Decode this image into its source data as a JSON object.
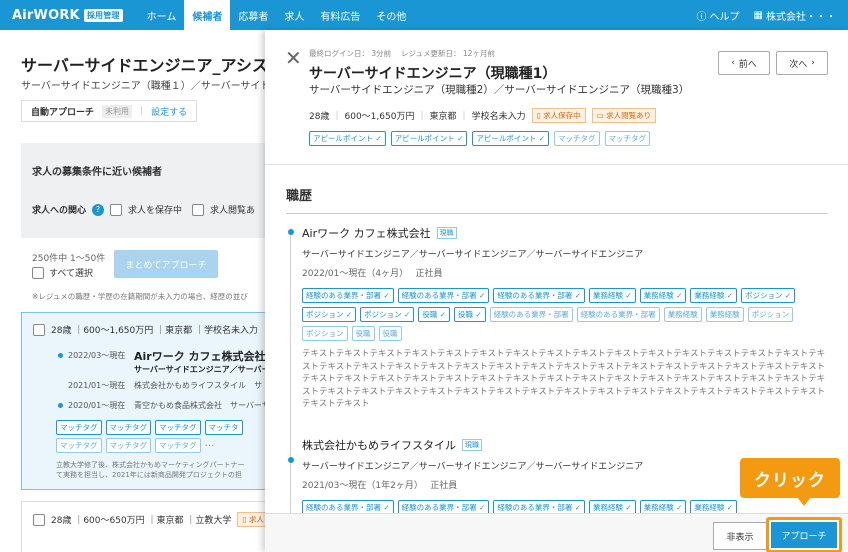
{
  "topbar": {
    "logo": "AirWORK",
    "logo_badge": "採用管理",
    "nav": [
      "ホーム",
      "候補者",
      "応募者",
      "求人",
      "有料広告",
      "その他"
    ],
    "help": "ヘルプ",
    "company": "株式会社・・・"
  },
  "left": {
    "title": "サーバーサイドエンジニア_アシス",
    "subtitle": "サーバーサイドエンジニア（職種１）／サーバーサイドエン",
    "auto_label": "自動アプローチ",
    "auto_status": "未利用",
    "auto_link": "設定する",
    "filter_title": "求人の募集条件に近い候補者",
    "interest_label": "求人への関心",
    "opt_saved": "求人を保存中",
    "opt_viewed": "求人閲覧あ",
    "count": "250件中 1〜50件",
    "select_all": "すべて選択",
    "bulk_button": "まとめてアプローチ",
    "note": "※レジュメの職歴・学歴の在籍期間が未入力の場合、経歴の並び"
  },
  "card1": {
    "summary": "28歳 ｜600〜1,650万円 ｜東京都 ｜学校名未入力",
    "period1": "2022/03〜現在",
    "company1": "Airワーク カフェ株式会社",
    "role1": "サーバーサイドエンジニア／サーバー",
    "period2": "2021/01〜現在",
    "company2": "株式会社かもめライフスタイル　サ",
    "period3": "2020/01〜現在",
    "company3": "青空かもめ食品株式会社　サーバーサ",
    "tags_row1": [
      "マッチタグ",
      "マッチタグ",
      "マッチタグ",
      "マッチタ"
    ],
    "tags_row2": [
      "マッチタグ",
      "マッチタグ",
      "マッチタグ"
    ],
    "ellipsis": "…",
    "desc1": "立教大学修了後、株式会社かもめマーケティングパートナー",
    "desc2": "て実務を担当し、2021年には新商品開発プロジェクトの担"
  },
  "card2": {
    "summary": "28歳 ｜600〜650万円 ｜東京都 ｜立教大学",
    "badge": "求人"
  },
  "panel": {
    "login_meta": "最終ログイン日： 3分前　 レジュメ更新日： 12ヶ月前",
    "name": "サーバーサイドエンジニア（現職種1）",
    "sub": "サーバーサイドエンジニア（現職種2）／サーバーサイドエンジニア（現職種3）",
    "age": "28歳",
    "salary": "600〜1,650万円",
    "location": "東京都",
    "school": "学校名未入力",
    "saved_badge": "求人保存中",
    "viewed_badge": "求人閲覧あり",
    "appeal_tags": [
      "アピールポイント",
      "アピールポイント",
      "アピールポイント"
    ],
    "match_tags": [
      "マッチタグ",
      "マッチタグ"
    ],
    "prev": "前へ",
    "next": "次へ",
    "section_title": "職歴",
    "job1": {
      "company": "Airワーク カフェ株式会社",
      "badge": "現職",
      "role": "サーバーサイドエンジニア／サーバーサイドエンジニア／サーバーサイドエンジニア",
      "period": "2022/01〜現在（4ヶ月）　 正社員",
      "tags": [
        {
          "label": "経験のある業界・部署",
          "checked": true
        },
        {
          "label": "経験のある業界・部署",
          "checked": true
        },
        {
          "label": "経験のある業界・部署",
          "checked": true
        },
        {
          "label": "業務経験",
          "checked": true
        },
        {
          "label": "業務経験",
          "checked": true
        },
        {
          "label": "業務経験",
          "checked": true
        },
        {
          "label": "ポジション",
          "checked": true
        },
        {
          "label": "ポジション",
          "checked": true
        },
        {
          "label": "ポジション",
          "checked": true
        },
        {
          "label": "役職",
          "checked": true
        },
        {
          "label": "役職",
          "checked": true
        },
        {
          "label": "経験のある業界・部署",
          "checked": false
        },
        {
          "label": "経験のある業界・部署",
          "checked": false
        },
        {
          "label": "業務経験",
          "checked": false
        },
        {
          "label": "業務経験",
          "checked": false
        },
        {
          "label": "ポジション",
          "checked": false
        },
        {
          "label": "ポジション",
          "checked": false
        },
        {
          "label": "役職",
          "checked": false
        },
        {
          "label": "役職",
          "checked": false
        }
      ],
      "text": "テキストテキストテキストテキストテキストテキストテキストテキストテキストテキストテキストテキストテキストテキストテキストテキストテキストテキストテキストテキストテキストテキストテキストテキストテキストテキストテキストテキストテキストテキストテキストテキストテキストテキストテキストテキストテキストテキストテキストテキストテキストテキストテキストテキストテキストテキストテキストテキストテキストテキストテキストテキストテキストテキストテキストテキストテキストテキストテキストテキストテキストテキストテキストテキスト"
    },
    "job2": {
      "company": "株式会社かもめライフスタイル",
      "badge": "現職",
      "role": "サーバーサイドエンジニア／サーバーサイドエンジニア／サーバーサイドエンジニア",
      "period": "2021/03〜現在（1年2ヶ月）　 正社員",
      "tags": [
        {
          "label": "経験のある業界・部署",
          "checked": true
        },
        {
          "label": "経験のある業界・部署",
          "checked": true
        },
        {
          "label": "経験のある業界・部署",
          "checked": true
        },
        {
          "label": "業務経験",
          "checked": true
        },
        {
          "label": "業務経験",
          "checked": true
        },
        {
          "label": "業務経験",
          "checked": true
        }
      ]
    },
    "hide_button": "非表示",
    "approach_button": "アプローチ",
    "callout": "クリック"
  },
  "colors": {
    "primary": "#1a96d4",
    "accent": "#f39a10"
  }
}
